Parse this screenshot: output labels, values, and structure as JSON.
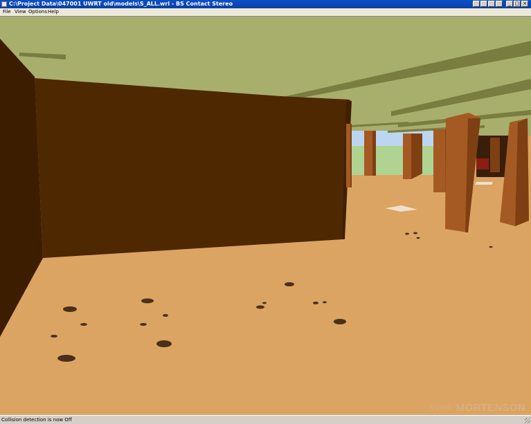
{
  "window": {
    "title": "C:\\Project Data\\047001 UWRT old\\models\\S_ALL.wrl - BS Contact Stereo",
    "controls": {
      "minimize": "_",
      "maximize": "□",
      "close": "×"
    }
  },
  "menu": {
    "items": [
      "File",
      "View",
      "Options",
      "Help"
    ]
  },
  "scene": {
    "watermark_copyright": "©2005",
    "watermark_brand": "MORTENSON",
    "colors": {
      "ceiling": "#a8ae6c",
      "floor": "#dba463",
      "wall": "#4e2800",
      "column_front": "#a55a23",
      "column_side": "#7e4012",
      "beam": "#7a7d40",
      "sky": "#bcd6f2",
      "grass": "#b0d392"
    }
  },
  "status": {
    "text": "Collision detection is now Off"
  }
}
